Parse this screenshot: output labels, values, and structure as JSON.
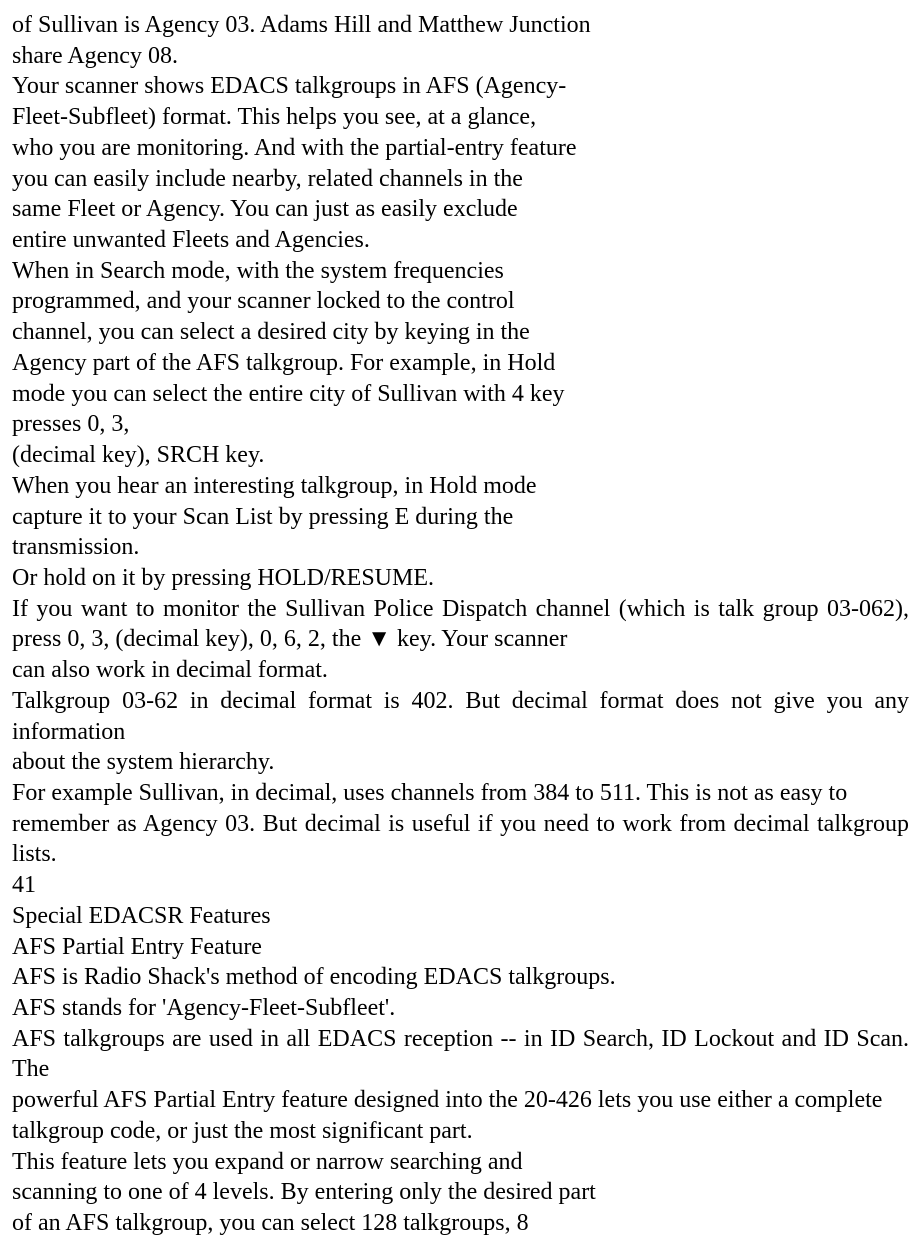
{
  "lines": [
    "of Sullivan is Agency 03. Adams Hill and Matthew Junction",
    "share Agency 08.",
    "Your scanner shows EDACS talkgroups in AFS (Agency-",
    "Fleet-Subfleet) format. This helps you see, at a glance,",
    "who you are monitoring. And with the partial-entry feature",
    "you can easily include nearby, related channels in the",
    "same Fleet or Agency. You can just as easily exclude",
    "entire unwanted Fleets and Agencies.",
    "When in Search mode, with the system frequencies",
    "programmed, and your scanner locked to the control",
    "channel, you can select a desired city by keying in the",
    "Agency part of the AFS talkgroup. For example, in Hold",
    "mode you can select the entire city of Sullivan with 4 key",
    "presses 0, 3,",
    "(decimal key), SRCH key.",
    "When you hear an interesting talkgroup, in Hold mode",
    "capture it to your Scan List by pressing E during the",
    "transmission.",
    "Or hold on it by pressing HOLD/RESUME.",
    "If you want to monitor the Sullivan Police Dispatch channel  (which is talk group 03-062), press 0, 3, (decimal key), 0, 6, 2, the ▼  key. Your scanner",
    "can also work in decimal format.",
    "Talkgroup 03-62 in decimal format is 402. But decimal format does not give you any information",
    "about the system hierarchy.",
    "For example Sullivan, in decimal, uses channels from 384 to 511. This is not as easy to",
    "remember as Agency 03. But decimal is useful if you need to work from decimal talkgroup lists.",
    "41",
    "Special EDACSR Features",
    "AFS Partial Entry Feature",
    "AFS is Radio Shack's method of encoding EDACS talkgroups.",
    "AFS stands for 'Agency-Fleet-Subfleet'.",
    "AFS talkgroups are used in all EDACS reception -- in ID Search, ID Lockout and ID Scan. The",
    "powerful AFS Partial Entry feature designed into the 20-426 lets you use either a complete",
    "talkgroup code, or just the most significant part.",
    "This feature lets you expand or narrow searching and",
    "scanning to one of 4 levels. By entering only the desired part",
    "of an AFS talkgroup, you can select 128 talkgroups, 8"
  ],
  "left_align_lines": [
    0,
    1,
    2,
    3,
    4,
    5,
    6,
    7,
    8,
    9,
    10,
    11,
    12,
    13,
    14,
    15,
    16,
    17,
    18,
    20,
    22,
    25,
    26,
    27,
    28,
    29,
    32,
    33,
    34,
    35
  ]
}
